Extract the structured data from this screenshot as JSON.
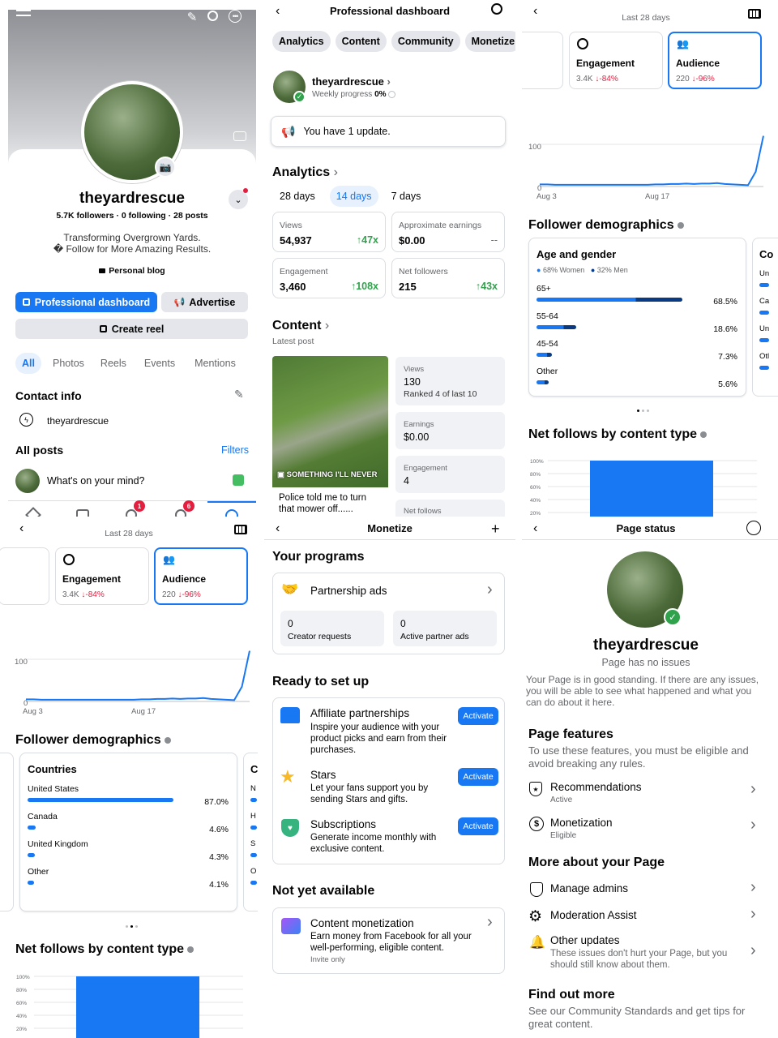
{
  "profile": {
    "name": "theyardrescue",
    "stats": "5.7K followers · 0 following · 28 posts",
    "bio1": "Transforming Overgrown Yards.",
    "bio2": "� Follow for More Amazing Results.",
    "category": "Personal blog",
    "btn_dashboard": "Professional dashboard",
    "btn_advertise": "Advertise",
    "btn_reel": "Create reel",
    "tabs": [
      "All",
      "Photos",
      "Reels",
      "Events",
      "Mentions"
    ],
    "contact_title": "Contact info",
    "contact_messenger": "theyardrescue",
    "posts_title": "All posts",
    "filters": "Filters",
    "composer": "What's on your mind?",
    "badge1": "1",
    "badge2": "6"
  },
  "dashboard": {
    "title": "Professional dashboard",
    "tabs": [
      "Analytics",
      "Content",
      "Community",
      "Monetize"
    ],
    "name": "theyardrescue",
    "weekly_label": "Weekly progress",
    "weekly_value": "0%",
    "update": "You have 1 update.",
    "analytics_title": "Analytics",
    "ranges": [
      "28 days",
      "14 days",
      "7 days"
    ],
    "metrics": [
      {
        "label": "Views",
        "value": "54,937",
        "delta": "47x"
      },
      {
        "label": "Approximate earnings",
        "value": "$0.00",
        "delta": "--"
      },
      {
        "label": "Engagement",
        "value": "3,460",
        "delta": "108x"
      },
      {
        "label": "Net followers",
        "value": "215",
        "delta": "43x"
      }
    ],
    "content_title": "Content",
    "latest_post": "Latest post",
    "thumb_overlay": "SOMETHING I'LL NEVER",
    "post_caption": "Police told me to turn that mower off......",
    "post_stats": [
      {
        "label": "Views",
        "value": "130",
        "extra": "Ranked 4 of last 10"
      },
      {
        "label": "Earnings",
        "value": "$0.00",
        "extra": ""
      },
      {
        "label": "Engagement",
        "value": "4",
        "extra": ""
      },
      {
        "label": "Net follows",
        "value": "",
        "extra": ""
      }
    ]
  },
  "insights": {
    "range": "Last 28 days",
    "engagement_label": "Engagement",
    "engagement_value": "3.4K",
    "engagement_delta": "-84%",
    "audience_label": "Audience",
    "audience_value": "220",
    "audience_delta": "-96%",
    "chart_y_100": "100",
    "chart_y_0": "0",
    "chart_x1": "Aug 3",
    "chart_x2": "Aug 17",
    "demographics_title": "Follower demographics",
    "age_title": "Age and gender",
    "women": "68% Women",
    "men": "32% Men",
    "ages": [
      {
        "label": "65+",
        "value": "68.5%"
      },
      {
        "label": "55-64",
        "value": "18.6%"
      },
      {
        "label": "45-54",
        "value": "7.3%"
      },
      {
        "label": "Other",
        "value": "5.6%"
      }
    ],
    "countries_title": "Countries",
    "countries": [
      {
        "label": "United States",
        "value": "87.0%"
      },
      {
        "label": "Canada",
        "value": "4.6%"
      },
      {
        "label": "United Kingdom",
        "value": "4.3%"
      },
      {
        "label": "Other",
        "value": "4.1%"
      }
    ],
    "peek_right_a": [
      "Co",
      "Un",
      "Ca",
      "Un",
      "Otl"
    ],
    "peek_right_b": [
      "C",
      "N",
      "H",
      "S",
      "O"
    ],
    "netfollows_title": "Net follows by content type",
    "yticks": [
      "100%",
      "80%",
      "60%",
      "40%",
      "20%"
    ]
  },
  "chart_data": [
    {
      "type": "line",
      "title": "Audience",
      "x_labels": [
        "Aug 3",
        "Aug 17"
      ],
      "ylim": [
        0,
        100
      ],
      "y_ticks": [
        0,
        100
      ],
      "values": [
        5,
        5,
        4,
        4,
        4,
        4,
        4,
        4,
        4,
        4,
        4,
        4,
        4,
        4,
        4,
        5,
        5,
        6,
        6,
        7,
        6,
        7,
        7,
        8,
        6,
        5,
        4,
        3,
        35,
        120
      ]
    },
    {
      "type": "bar",
      "title": "Net follows by content type",
      "y_ticks": [
        "100%",
        "80%",
        "60%",
        "40%",
        "20%"
      ],
      "values": [
        100
      ]
    }
  ],
  "monetize": {
    "title": "Monetize",
    "programs_title": "Your programs",
    "partnership": "Partnership ads",
    "creator_requests_v": "0",
    "creator_requests": "Creator requests",
    "active_ads_v": "0",
    "active_ads": "Active partner ads",
    "ready_title": "Ready to set up",
    "items": [
      {
        "title": "Affiliate partnerships",
        "desc": "Inspire your audience with your product picks and earn from their purchases.",
        "btn": "Activate"
      },
      {
        "title": "Stars",
        "desc": "Let your fans support you by sending Stars and gifts.",
        "btn": "Activate"
      },
      {
        "title": "Subscriptions",
        "desc": "Generate income monthly with exclusive content.",
        "btn": "Activate"
      }
    ],
    "not_yet_title": "Not yet available",
    "cm_title": "Content monetization",
    "cm_desc": "Earn money from Facebook for all your well-performing, eligible content.",
    "cm_note": "Invite only"
  },
  "status": {
    "title": "Page status",
    "name": "theyardrescue",
    "no_issues": "Page has no issues",
    "desc": "Your Page is in good standing. If there are any issues, you will be able to see what happened and what you can do about it here.",
    "features_title": "Page features",
    "features_desc": "To use these features, you must be eligible and avoid breaking any rules.",
    "rec": "Recommendations",
    "rec_sub": "Active",
    "mon": "Monetization",
    "mon_sub": "Eligible",
    "more_title": "More about your Page",
    "admins": "Manage admins",
    "moderation": "Moderation Assist",
    "other": "Other updates",
    "other_sub": "These issues don't hurt your Page, but you should still know about them.",
    "find_title": "Find out more",
    "find_desc": "See our Community Standards and get tips for great content."
  }
}
